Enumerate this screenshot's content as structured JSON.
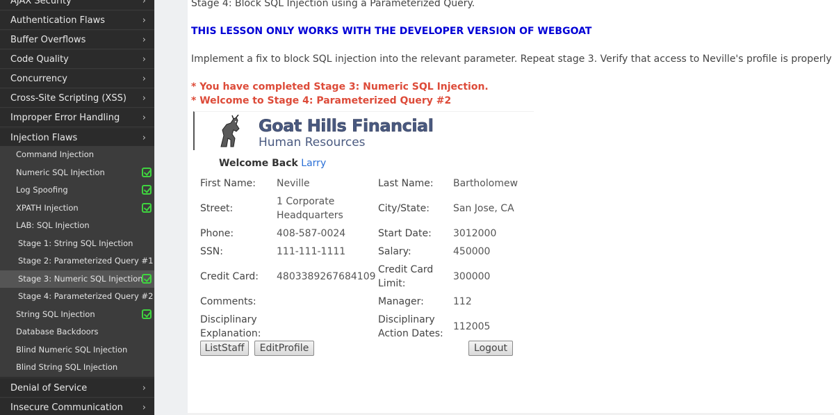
{
  "sidebar": {
    "categories": {
      "ajax": "AJAX Security",
      "auth": "Authentication Flaws",
      "buffer": "Buffer Overflows",
      "codequality": "Code Quality",
      "concurrency": "Concurrency",
      "xss": "Cross-Site Scripting (XSS)",
      "errors": "Improper Error Handling",
      "injection": "Injection Flaws",
      "dos": "Denial of Service",
      "insecure": "Insecure Communication"
    },
    "injection_items": {
      "command": "Command Injection",
      "numeric": "Numeric SQL Injection",
      "logspoof": "Log Spoofing",
      "xpath": "XPATH Injection",
      "lab": "LAB: SQL Injection",
      "stage1": "Stage 1: String SQL Injection",
      "stage2": "Stage 2: Parameterized Query #1",
      "stage3": "Stage 3: Numeric SQL Injection",
      "stage4": "Stage 4: Parameterized Query #2",
      "stringsql": "String SQL Injection",
      "backdoors": "Database Backdoors",
      "blindnum": "Blind Numeric SQL Injection",
      "blindstr": "Blind String SQL Injection"
    },
    "chevron": "›"
  },
  "lesson": {
    "stage_line": "Stage 4: Block SQL Injection using a Parameterized Query.",
    "dev_warning": "THIS LESSON ONLY WORKS WITH THE DEVELOPER VERSION OF WEBGOAT",
    "instructions": "Implement a fix to block SQL injection into the relevant parameter. Repeat stage 3. Verify that access to Neville's profile is properly blocked.",
    "msg_completed": "* You have completed Stage 3: Numeric SQL Injection.",
    "msg_welcome": "* Welcome to Stage 4: Parameterized Query #2"
  },
  "app": {
    "company": "Goat Hills Financial",
    "department": "Human Resources",
    "welcome_prefix": "Welcome Back",
    "user": "Larry"
  },
  "profile": {
    "first_name_label": "First Name:",
    "first_name": "Neville",
    "last_name_label": "Last Name:",
    "last_name": "Bartholomew",
    "street_label": "Street:",
    "street_line1": "1 Corporate",
    "street_line2": "Headquarters",
    "city_label": "City/State:",
    "city": "San Jose, CA",
    "phone_label": "Phone:",
    "phone": "408-587-0024",
    "start_label": "Start Date:",
    "start": "3012000",
    "ssn_label": "SSN:",
    "ssn": "111-111-1111",
    "salary_label": "Salary:",
    "salary": "450000",
    "cc_label": "Credit Card:",
    "cc": "4803389267684109",
    "cclimit_label1": "Credit Card",
    "cclimit_label2": "Limit:",
    "cclimit": "300000",
    "comments_label": "Comments:",
    "manager_label": "Manager:",
    "manager": "112",
    "disc_expl_label1": "Disciplinary",
    "disc_expl_label2": "Explanation:",
    "disc_dates_label1": "Disciplinary",
    "disc_dates_label2": "Action Dates:",
    "disc_dates": "112005"
  },
  "buttons": {
    "list_staff": "ListStaff",
    "edit_profile": "EditProfile",
    "logout": "Logout"
  },
  "colors": {
    "sidebar_bg": "#2f2f2f",
    "sub_bg": "#3c3c3c",
    "active_bg": "#555555",
    "check": "#3fd33f",
    "warning": "#0000d6",
    "message": "#dd4b39",
    "brand": "#4a5a80",
    "link": "#2a6fd6"
  }
}
